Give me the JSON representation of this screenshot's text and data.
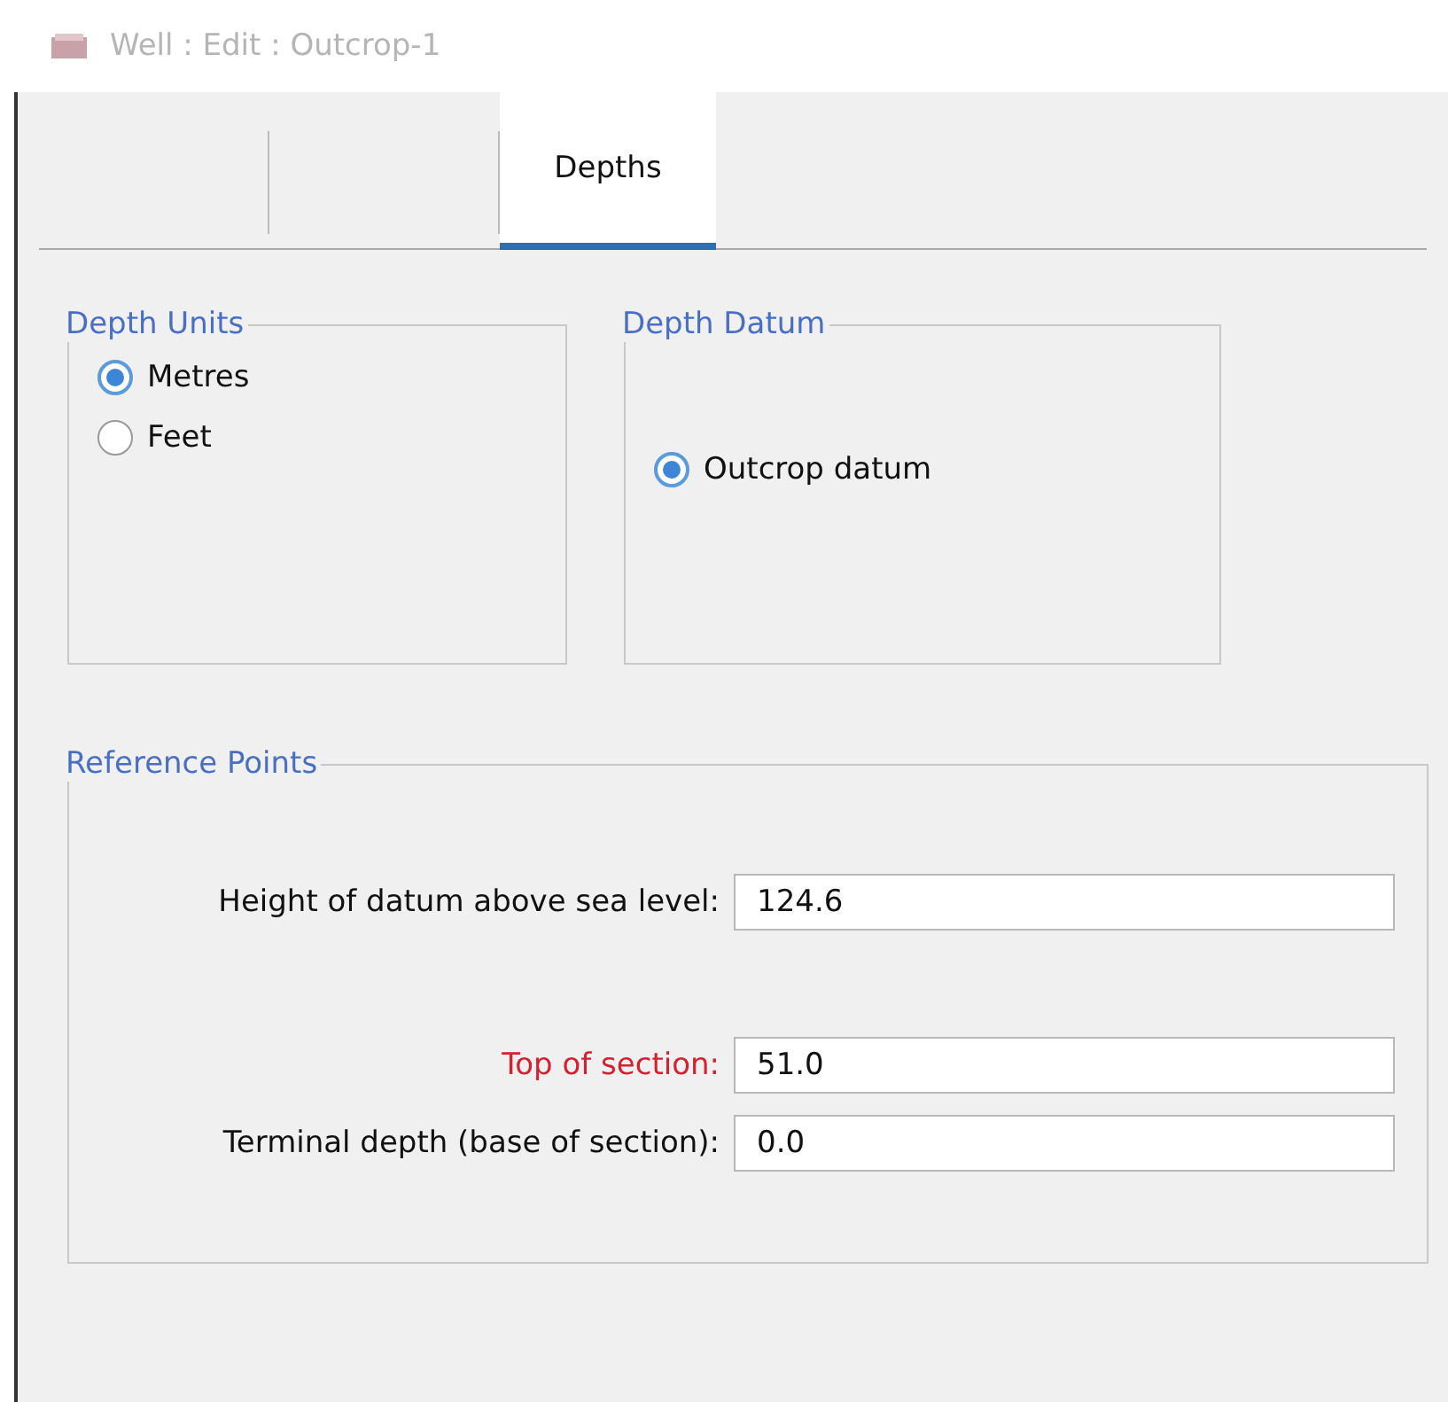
{
  "window": {
    "title": "Well : Edit : Outcrop-1"
  },
  "tabs": [
    {
      "selected": false
    },
    {
      "selected": false
    },
    {
      "label": "Depths",
      "selected": true
    }
  ],
  "depth_units": {
    "title": "Depth Units",
    "options": [
      {
        "label": "Metres",
        "selected": true
      },
      {
        "label": "Feet",
        "selected": false
      }
    ]
  },
  "depth_datum": {
    "title": "Depth Datum",
    "options": [
      {
        "label": "Outcrop datum",
        "selected": true
      }
    ]
  },
  "reference_points": {
    "title": "Reference Points",
    "fields": [
      {
        "label": "Height of datum above sea level:",
        "value": "124.6",
        "invalid": false
      },
      {
        "label": "Top of section:",
        "value": "51.0",
        "invalid": true
      },
      {
        "label": "Terminal depth (base of section):",
        "value": "0.0",
        "invalid": false
      }
    ]
  }
}
